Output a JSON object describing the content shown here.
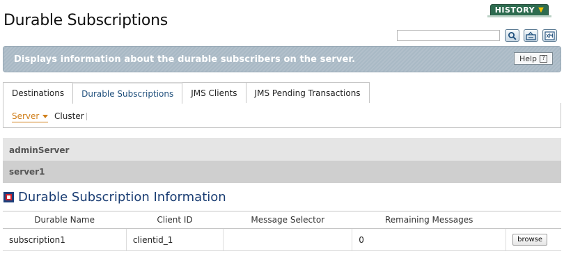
{
  "page": {
    "title": "Durable Subscriptions"
  },
  "header": {
    "history_label": "HISTORY",
    "search_placeholder": ""
  },
  "banner": {
    "text": "Displays information about the durable subscribers on the server.",
    "help_label": "Help",
    "help_icon_label": "?"
  },
  "tabs": [
    {
      "label": "Destinations",
      "active": false
    },
    {
      "label": "Durable Subscriptions",
      "active": true
    },
    {
      "label": "JMS Clients",
      "active": false
    },
    {
      "label": "JMS Pending Transactions",
      "active": false
    }
  ],
  "subnav": {
    "server_label": "Server",
    "cluster_label": "Cluster"
  },
  "servers": [
    {
      "name": "adminServer"
    },
    {
      "name": "server1"
    }
  ],
  "section": {
    "title": "Durable Subscription Information"
  },
  "table": {
    "headers": [
      "Durable Name",
      "Client ID",
      "Message Selector",
      "Remaining Messages",
      ""
    ],
    "rows": [
      {
        "durable_name": "subscription1",
        "client_id": "clientid_1",
        "message_selector": "",
        "remaining_messages": "0",
        "action_label": "browse"
      }
    ]
  },
  "colors": {
    "accent_orange": "#d07f1a",
    "history_green": "#2d6b4f",
    "banner_bg": "#a9b9c5",
    "title_blue": "#1a3d73"
  },
  "icons": {
    "search": "search-icon",
    "refresh": "refresh-icon",
    "xml": "xml-icon",
    "chevron": "chevron-down-icon",
    "section": "section-marker-icon"
  }
}
